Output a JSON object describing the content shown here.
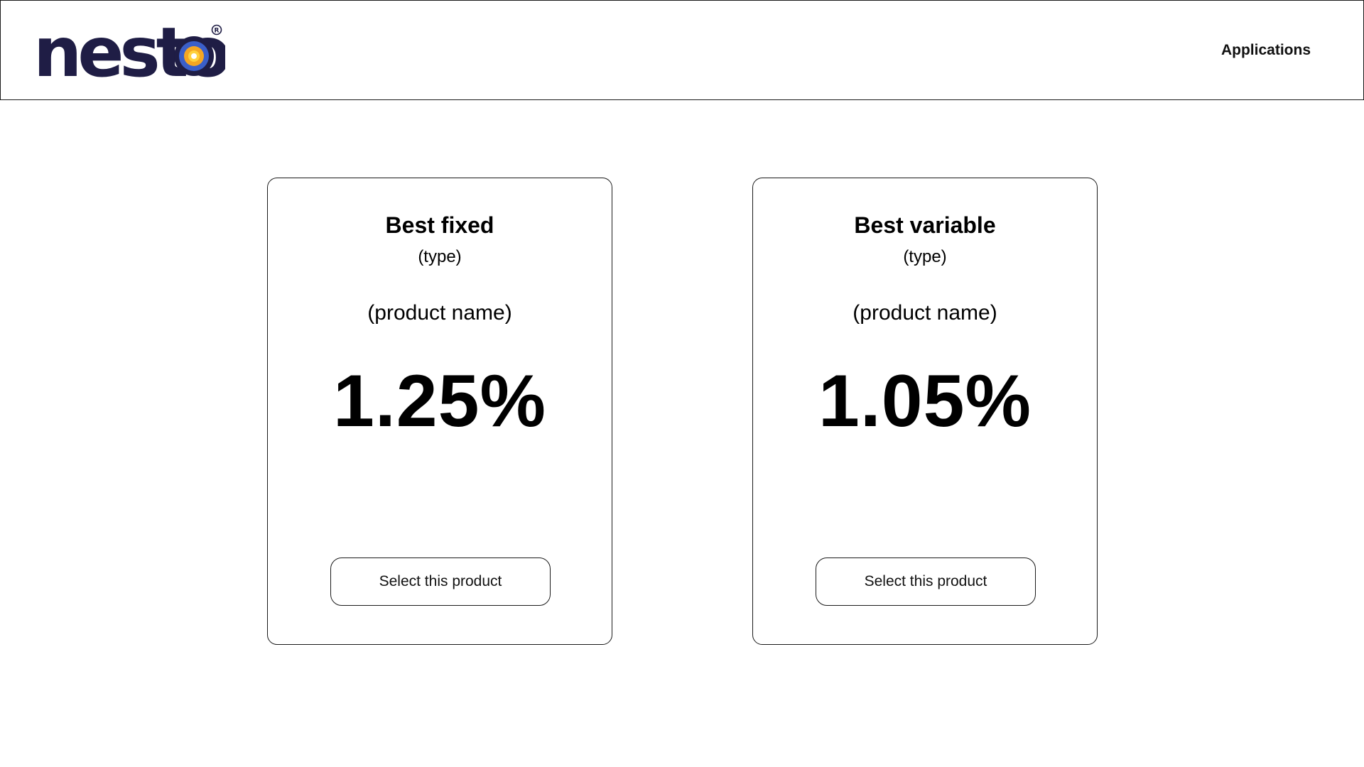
{
  "header": {
    "logo_text": "nesto",
    "nav_label": "Applications"
  },
  "colors": {
    "logo_navy": "#1f1d45",
    "target_outer": "#3b5fc9",
    "target_mid": "#f5a623",
    "target_inner": "#ffd23f"
  },
  "products": [
    {
      "title": "Best fixed",
      "type": "(type)",
      "product_name": "(product name)",
      "rate": "1.25%",
      "button_label": "Select this product"
    },
    {
      "title": "Best variable",
      "type": "(type)",
      "product_name": "(product name)",
      "rate": "1.05%",
      "button_label": "Select this product"
    }
  ]
}
